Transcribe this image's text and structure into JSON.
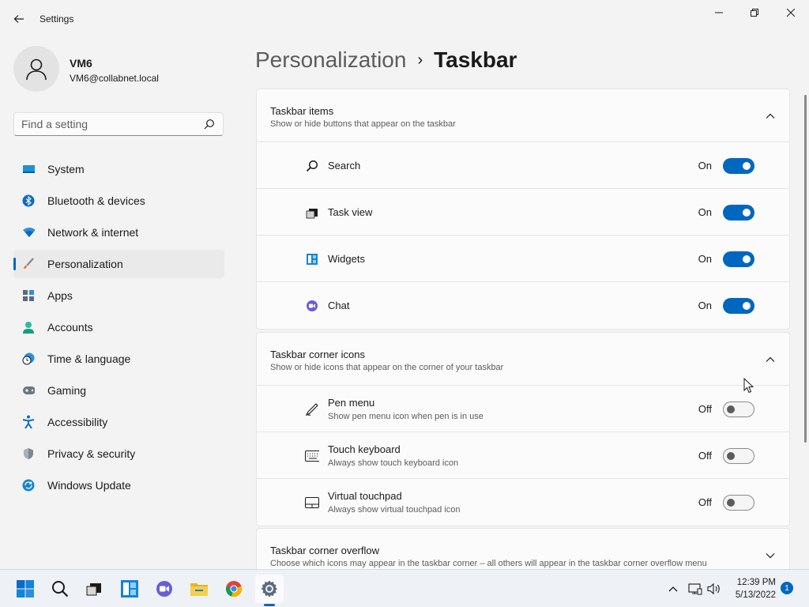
{
  "app": {
    "title": "Settings"
  },
  "user": {
    "name": "VM6",
    "email": "VM6@collabnet.local"
  },
  "search": {
    "placeholder": "Find a setting"
  },
  "nav": {
    "items": [
      {
        "label": "System",
        "icon": "monitor-icon"
      },
      {
        "label": "Bluetooth & devices",
        "icon": "bluetooth-icon"
      },
      {
        "label": "Network & internet",
        "icon": "wifi-icon"
      },
      {
        "label": "Personalization",
        "icon": "brush-icon",
        "active": true
      },
      {
        "label": "Apps",
        "icon": "apps-icon"
      },
      {
        "label": "Accounts",
        "icon": "person-icon"
      },
      {
        "label": "Time & language",
        "icon": "clock-globe-icon"
      },
      {
        "label": "Gaming",
        "icon": "gamepad-icon"
      },
      {
        "label": "Accessibility",
        "icon": "accessibility-icon"
      },
      {
        "label": "Privacy & security",
        "icon": "shield-icon"
      },
      {
        "label": "Windows Update",
        "icon": "update-icon"
      }
    ]
  },
  "breadcrumb": {
    "parent": "Personalization",
    "separator": "›",
    "current": "Taskbar"
  },
  "sections": {
    "taskbar_items": {
      "title": "Taskbar items",
      "subtitle": "Show or hide buttons that appear on the taskbar",
      "rows": [
        {
          "label": "Search",
          "state": "On",
          "icon": "search-icon"
        },
        {
          "label": "Task view",
          "state": "On",
          "icon": "task-view-icon"
        },
        {
          "label": "Widgets",
          "state": "On",
          "icon": "widgets-icon"
        },
        {
          "label": "Chat",
          "state": "On",
          "icon": "chat-icon"
        }
      ]
    },
    "corner_icons": {
      "title": "Taskbar corner icons",
      "subtitle": "Show or hide icons that appear on the corner of your taskbar",
      "rows": [
        {
          "label": "Pen menu",
          "sub": "Show pen menu icon when pen is in use",
          "state": "Off",
          "icon": "pen-icon"
        },
        {
          "label": "Touch keyboard",
          "sub": "Always show touch keyboard icon",
          "state": "Off",
          "icon": "keyboard-icon"
        },
        {
          "label": "Virtual touchpad",
          "sub": "Always show virtual touchpad icon",
          "state": "Off",
          "icon": "touchpad-icon"
        }
      ]
    },
    "corner_overflow": {
      "title": "Taskbar corner overflow",
      "subtitle": "Choose which icons may appear in the taskbar corner – all others will appear in the taskbar corner overflow menu"
    }
  },
  "taskbar": {
    "time": "12:39 PM",
    "date": "5/13/2022",
    "notifications": "1"
  },
  "colors": {
    "accent": "#0067c0",
    "background": "#f3f3f3",
    "card": "#fbfbfb"
  }
}
